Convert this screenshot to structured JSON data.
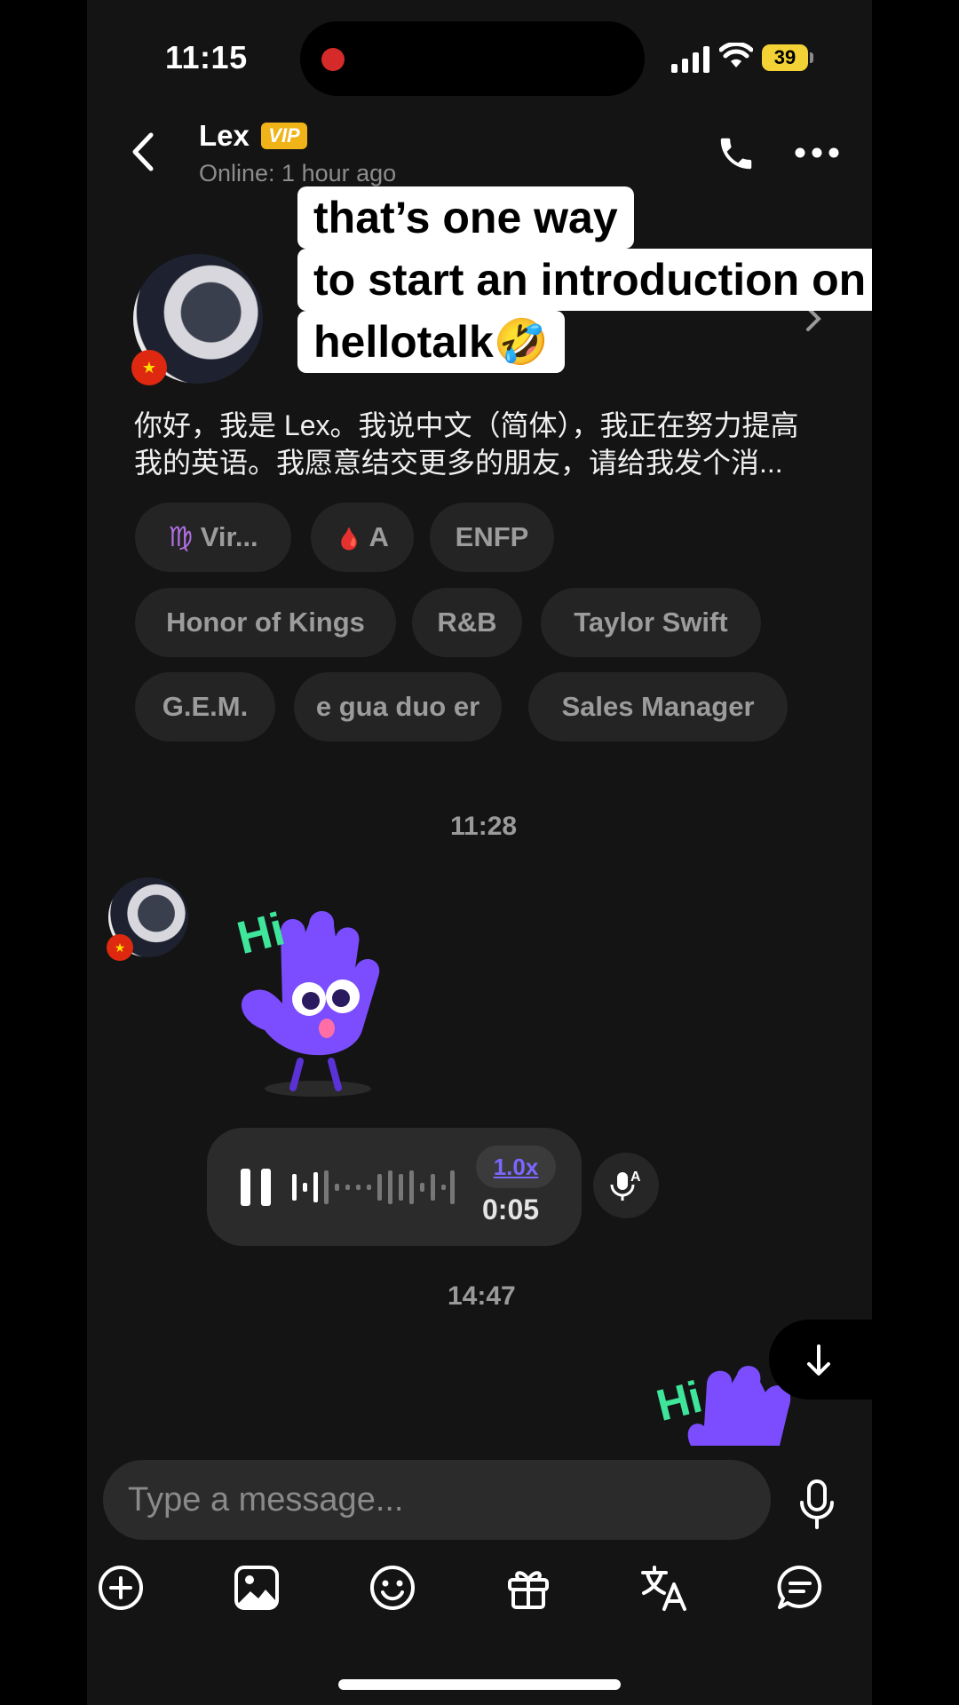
{
  "status_bar": {
    "time": "11:15",
    "battery": "39"
  },
  "header": {
    "name": "Lex",
    "badge": "VIP",
    "online": "Online: 1 hour ago"
  },
  "profile": {
    "intro_line1": "你好，我是 Lex。我说中文（简体），我正在努力提高",
    "intro_line2": "我的英语。我愿意结交更多的朋友，请给我发个消...",
    "tags": {
      "zodiac_icon": "♍",
      "zodiac": "Vir...",
      "blood_icon": "🩸",
      "blood": "A",
      "mbti": "ENFP",
      "tag1": "Honor of Kings",
      "tag2": "R&B",
      "tag3": "Taylor Swift",
      "tag4": "G.E.M.",
      "tag5": "e gua duo er",
      "tag6": "Sales Manager"
    }
  },
  "chat": {
    "timestamp1": "11:28",
    "sticker_text": "Hi",
    "voice": {
      "speed": "1.0x",
      "duration": "0:05"
    },
    "timestamp2": "14:47"
  },
  "input": {
    "placeholder": "Type a message..."
  },
  "caption": {
    "line1": "that’s one way",
    "line2": "to start an introduction on",
    "line3": "hellotalk🤣"
  },
  "icons": {
    "toolbar": [
      "plus-circle-icon",
      "image-icon",
      "smiley-icon",
      "gift-icon",
      "translate-icon",
      "chat-bubble-icon"
    ]
  }
}
